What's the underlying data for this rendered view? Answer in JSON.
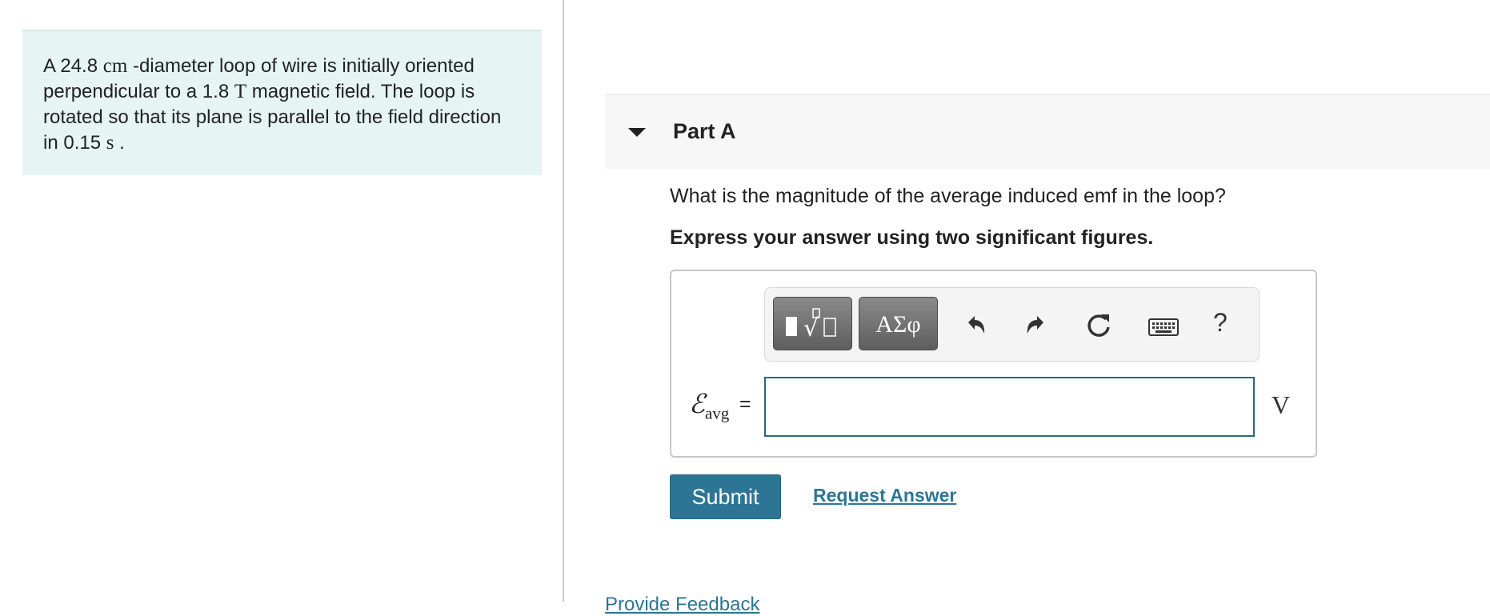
{
  "problem": {
    "text_1": "A 24.8 ",
    "unit_cm": "cm",
    "text_2": " -diameter loop of wire is initially oriented perpendicular to a 1.8 ",
    "unit_T": "T",
    "text_3": " magnetic field. The loop is rotated so that its plane is parallel to the field direction in 0.15 ",
    "unit_s": "s",
    "text_4": " ."
  },
  "part": {
    "title": "Part A",
    "question": "What is the magnitude of the average induced emf in the loop?",
    "instruction": "Express your answer using two significant figures."
  },
  "toolbar": {
    "templates_icon": "templates-icon",
    "symbols_label": "ΑΣφ",
    "undo_icon": "undo-icon",
    "redo_icon": "redo-icon",
    "reset_icon": "reset-icon",
    "keyboard_icon": "keyboard-icon",
    "help_label": "?"
  },
  "answer": {
    "label_symbol": "ℰ",
    "label_sub": "avg",
    "equals": "=",
    "value": "",
    "unit": "V"
  },
  "actions": {
    "submit_label": "Submit",
    "request_label": "Request Answer",
    "feedback_label": "Provide Feedback"
  },
  "colors": {
    "problem_bg": "#e6f4f4",
    "accent": "#2d7595",
    "input_border": "#2a6a78"
  }
}
